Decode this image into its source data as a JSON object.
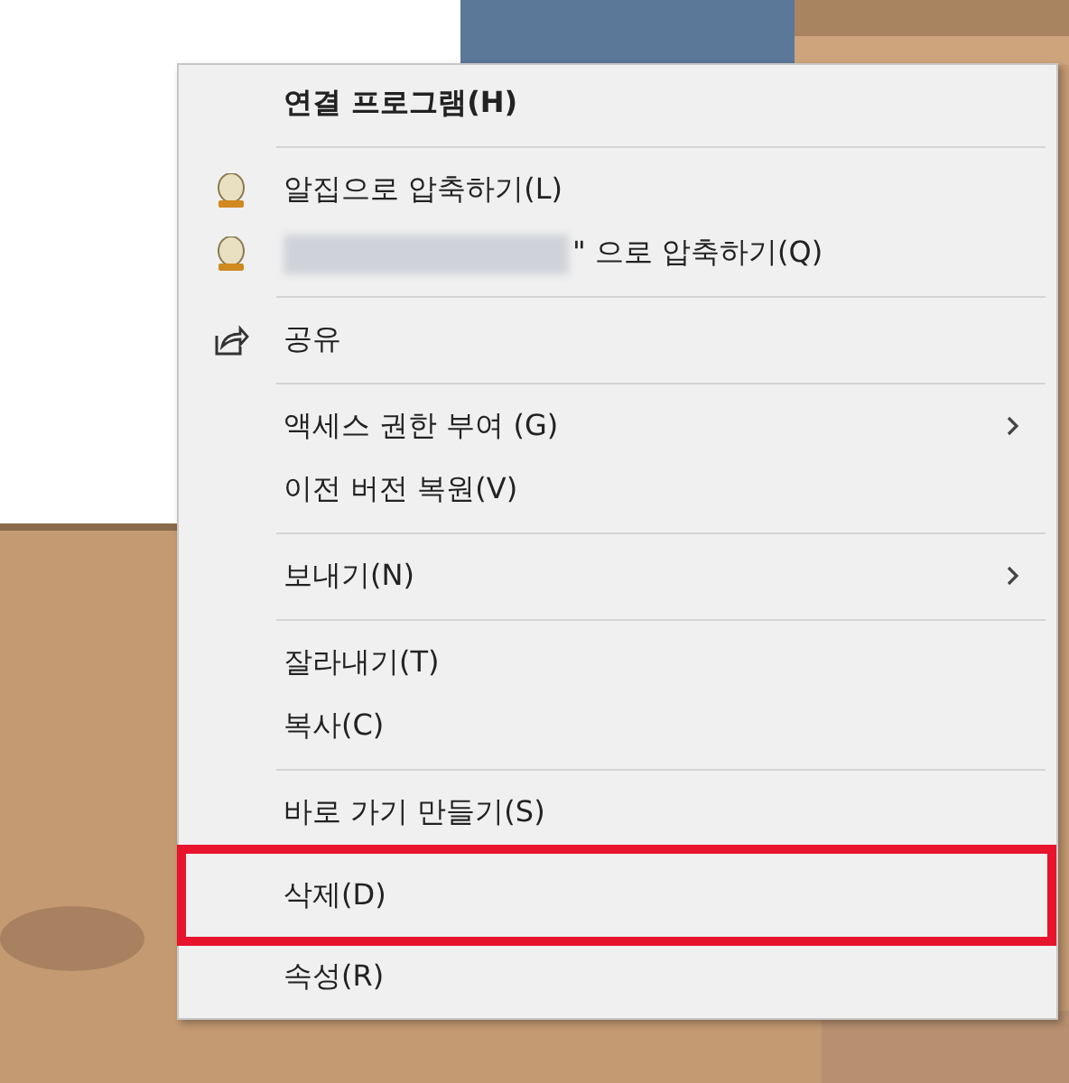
{
  "menu": [
    {
      "kind": "plain",
      "label": "연결 프로그램(H)",
      "default": true,
      "submenu": false,
      "highlighted": false
    },
    {
      "kind": "separator"
    },
    {
      "kind": "alzip",
      "label": "알집으로 압축하기(L)",
      "default": false,
      "submenu": false,
      "highlighted": false
    },
    {
      "kind": "alzip",
      "label": "\" 으로 압축하기(Q)",
      "redacted_prefix": true,
      "default": false,
      "submenu": false,
      "highlighted": false
    },
    {
      "kind": "separator"
    },
    {
      "kind": "share",
      "label": "공유",
      "default": false,
      "submenu": false,
      "highlighted": false
    },
    {
      "kind": "separator"
    },
    {
      "kind": "plain",
      "label": "액세스 권한 부여 (G)",
      "default": false,
      "submenu": true,
      "highlighted": false
    },
    {
      "kind": "plain",
      "label": "이전 버전 복원(V)",
      "default": false,
      "submenu": false,
      "highlighted": false
    },
    {
      "kind": "separator"
    },
    {
      "kind": "plain",
      "label": "보내기(N)",
      "default": false,
      "submenu": true,
      "highlighted": false
    },
    {
      "kind": "separator"
    },
    {
      "kind": "plain",
      "label": "잘라내기(T)",
      "default": false,
      "submenu": false,
      "highlighted": false
    },
    {
      "kind": "plain",
      "label": "복사(C)",
      "default": false,
      "submenu": false,
      "highlighted": false
    },
    {
      "kind": "separator"
    },
    {
      "kind": "plain",
      "label": "바로 가기 만들기(S)",
      "default": false,
      "submenu": false,
      "highlighted": false
    },
    {
      "kind": "plain",
      "label": "삭제(D)",
      "default": false,
      "submenu": false,
      "highlighted": true
    },
    {
      "kind": "plain",
      "label": "속성(R)",
      "default": false,
      "submenu": false,
      "highlighted": false
    }
  ]
}
